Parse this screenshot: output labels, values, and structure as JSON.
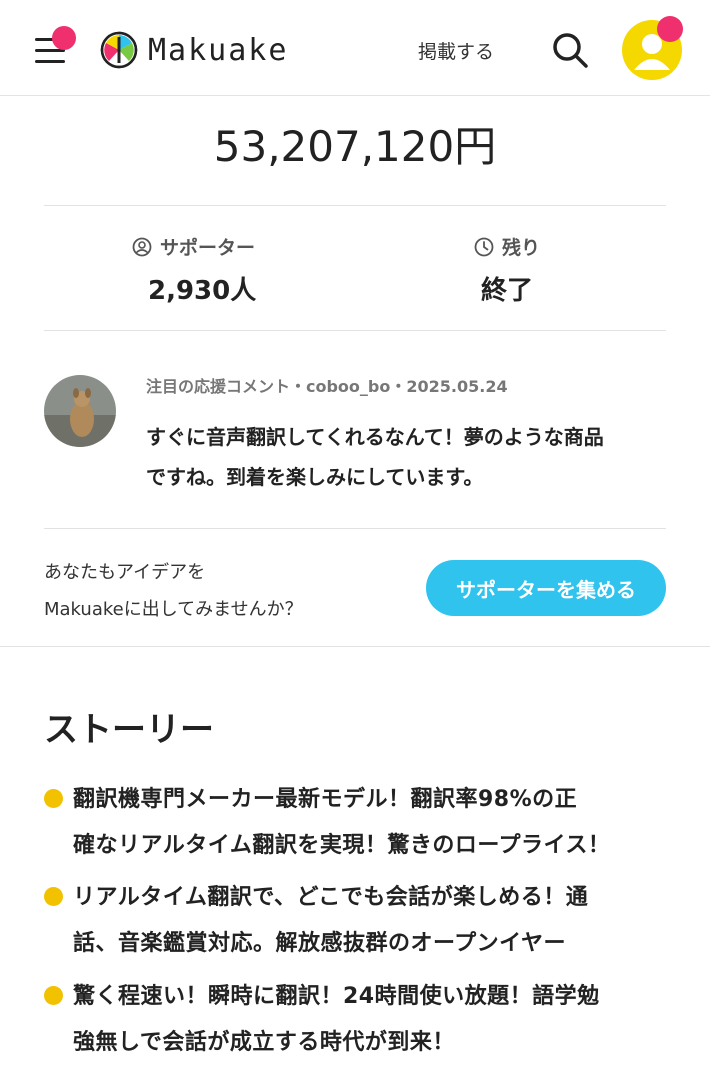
{
  "header": {
    "logo_text": "Makuake",
    "post_link": "掲載する",
    "icons": {
      "menu": "hamburger-menu-icon",
      "search": "search-icon",
      "avatar": "user-avatar-icon"
    },
    "colors": {
      "notification_dot": "#ef2f6e",
      "avatar_bg": "#f5d800"
    }
  },
  "funding": {
    "amount": "53,207,120円"
  },
  "stats": {
    "supporters_label": "サポーター",
    "supporters_value": "2,930人",
    "remaining_label": "残り",
    "remaining_value": "終了"
  },
  "featured_comment": {
    "meta": "注目の応援コメント・coboo_bo・2025.05.24",
    "line1": "すぐに音声翻訳してくれるなんて！夢のような商品",
    "line2": "ですね。到着を楽しみにしています。"
  },
  "promo": {
    "line1": "あなたもアイデアを",
    "line2": "Makuakeに出してみませんか？",
    "button_label": "サポーターを集める",
    "button_color": "#2fc3ee"
  },
  "story": {
    "title": "ストーリー",
    "bullet_color": "#f2c100",
    "bullets": [
      {
        "line1": "翻訳機専門メーカー最新モデル！翻訳率98%の正",
        "line2": "確なリアルタイム翻訳を実現！驚きのロープライス！"
      },
      {
        "line1": "リアルタイム翻訳で、どこでも会話が楽しめる！通",
        "line2": "話、音楽鑑賞対応。解放感抜群のオープンイヤー"
      },
      {
        "line1": "驚く程速い！瞬時に翻訳！24時間使い放題！語学勉",
        "line2": "強無しで会話が成立する時代が到来！"
      }
    ]
  }
}
